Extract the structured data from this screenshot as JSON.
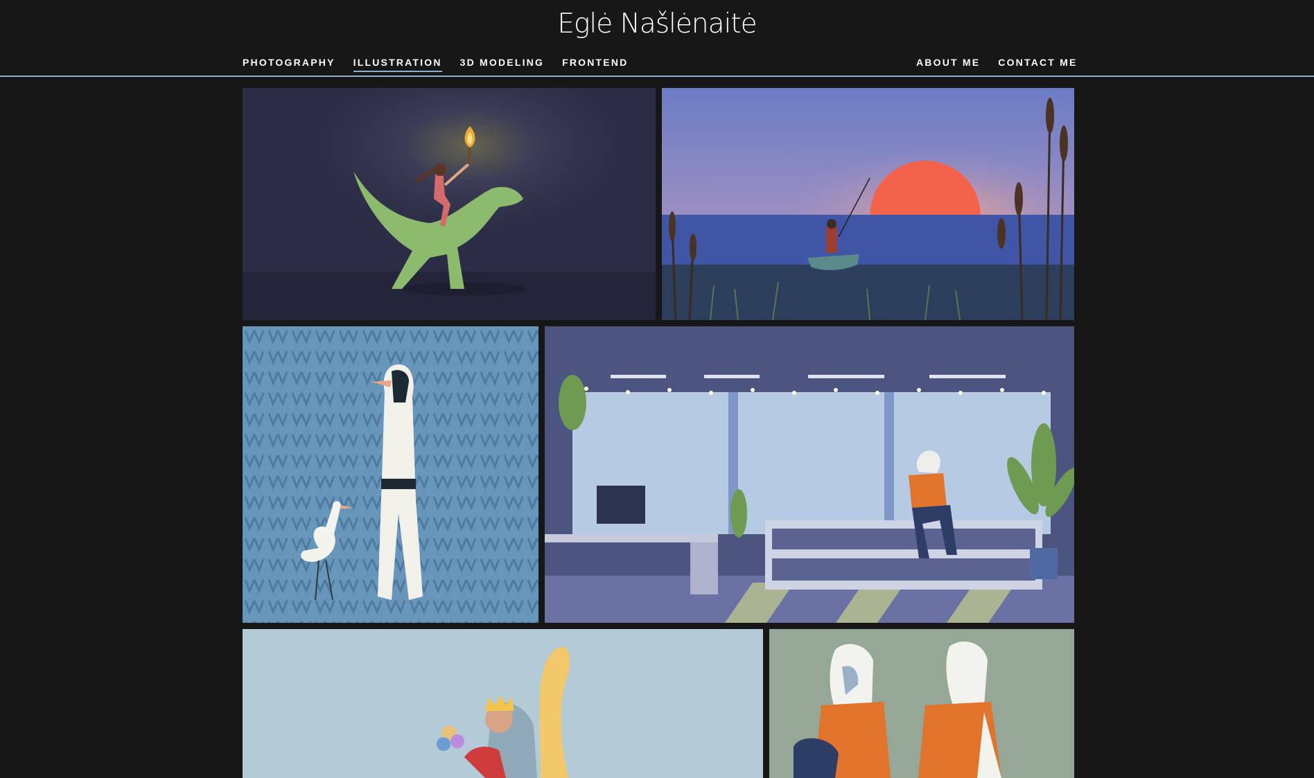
{
  "site": {
    "title": "Eglė Našlėnaitė"
  },
  "nav": {
    "left": [
      {
        "label": "PHOTOGRAPHY",
        "active": false
      },
      {
        "label": "ILLUSTRATION",
        "active": true
      },
      {
        "label": "3D MODELING",
        "active": false
      },
      {
        "label": "FRONTEND",
        "active": false
      }
    ],
    "right": [
      {
        "label": "ABOUT ME"
      },
      {
        "label": "CONTACT ME"
      }
    ]
  },
  "colors": {
    "background": "#171717",
    "accent": "#8fb0cf",
    "text": "#ffffff"
  }
}
